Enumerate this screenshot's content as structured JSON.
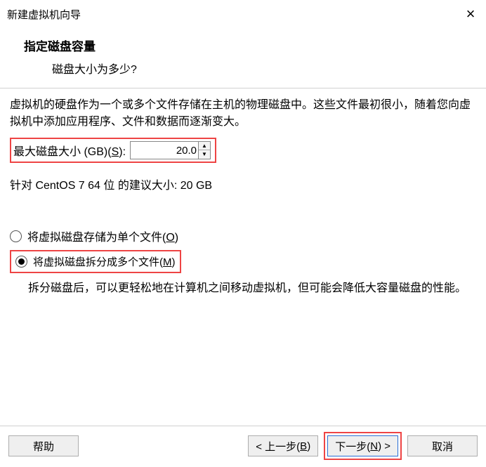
{
  "window": {
    "title": "新建虚拟机向导"
  },
  "header": {
    "heading": "指定磁盘容量",
    "subtext": "磁盘大小为多少?"
  },
  "desc": "虚拟机的硬盘作为一个或多个文件存储在主机的物理磁盘中。这些文件最初很小，随着您向虚拟机中添加应用程序、文件和数据而逐渐变大。",
  "size": {
    "label_prefix": "最大磁盘大小 (GB)(",
    "label_mn": "S",
    "label_suffix": "):",
    "value": "20.0",
    "recommend": "针对 CentOS 7 64 位 的建议大小: 20 GB"
  },
  "options": {
    "single": {
      "label_prefix": "将虚拟磁盘存储为单个文件(",
      "mn": "O",
      "label_suffix": ")"
    },
    "split": {
      "label_prefix": "将虚拟磁盘拆分成多个文件(",
      "mn": "M",
      "label_suffix": ")"
    },
    "split_desc": "拆分磁盘后，可以更轻松地在计算机之间移动虚拟机，但可能会降低大容量磁盘的性能。"
  },
  "buttons": {
    "help": "帮助",
    "back_prefix": "< 上一步(",
    "back_mn": "B",
    "back_suffix": ")",
    "next_prefix": "下一步(",
    "next_mn": "N",
    "next_suffix": ") >",
    "cancel": "取消"
  }
}
